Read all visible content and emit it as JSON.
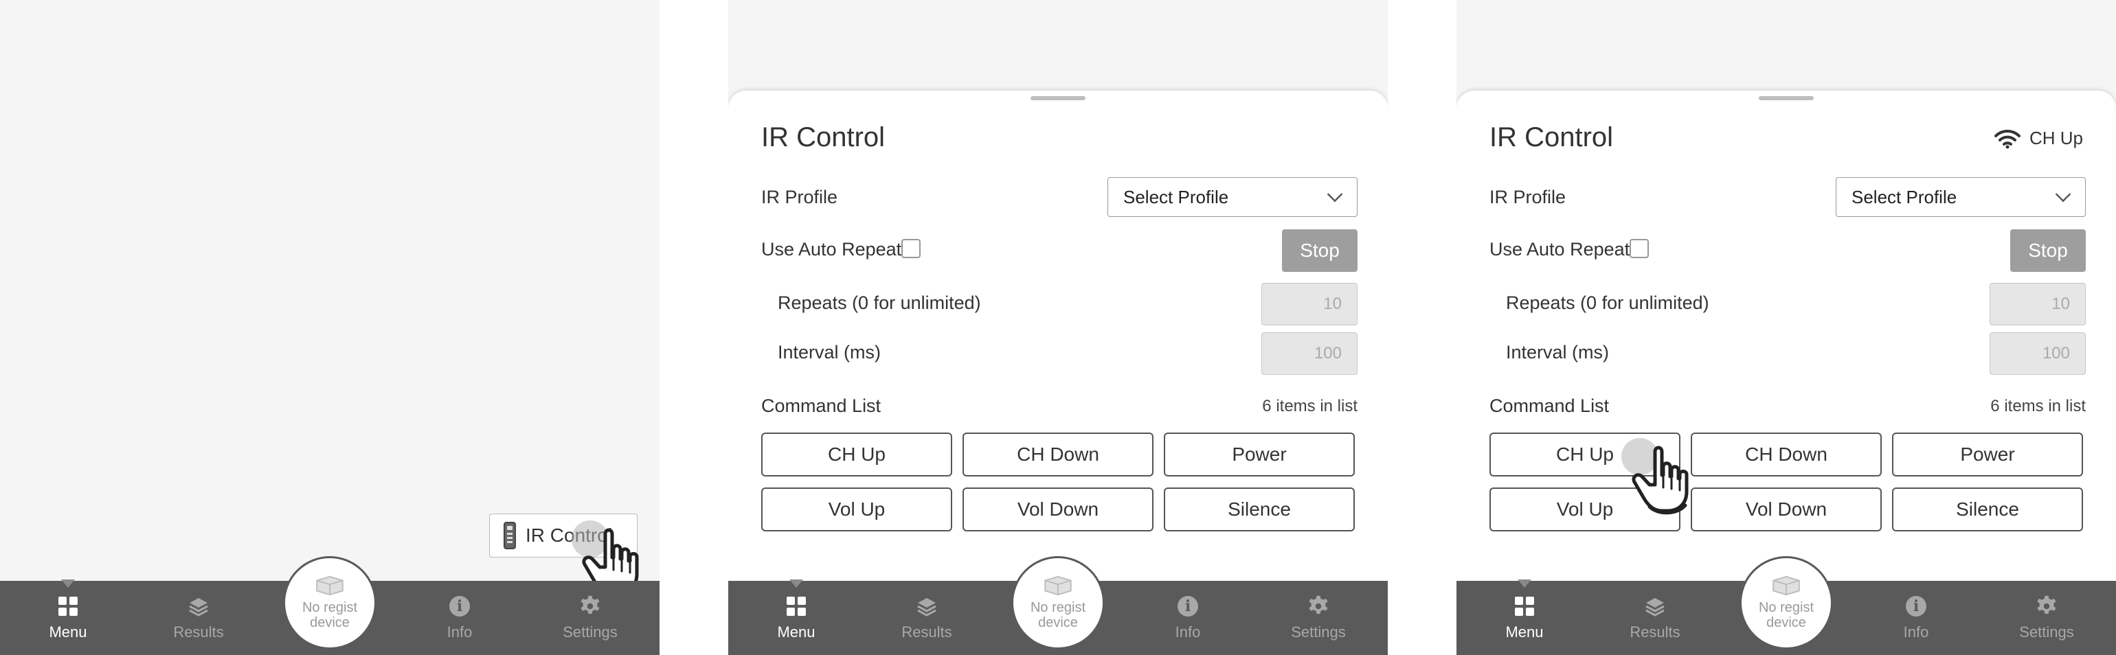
{
  "screens": [
    {
      "fab_label": "IR Control"
    },
    {
      "title": "IR Control",
      "status": "",
      "ir_profile_label": "IR Profile",
      "select_value": "Select Profile",
      "auto_repeat_label": "Use Auto Repeat",
      "stop_label": "Stop",
      "repeats_label": "Repeats (0 for unlimited)",
      "repeats_value": "10",
      "interval_label": "Interval (ms)",
      "interval_value": "100",
      "command_list_label": "Command List",
      "items_count": "6 items in list",
      "commands": [
        "CH Up",
        "CH Down",
        "Power",
        "Vol Up",
        "Vol Down",
        "Silence"
      ]
    },
    {
      "title": "IR Control",
      "status": "CH Up",
      "ir_profile_label": "IR Profile",
      "select_value": "Select Profile",
      "auto_repeat_label": "Use Auto Repeat",
      "stop_label": "Stop",
      "repeats_label": "Repeats (0 for unlimited)",
      "repeats_value": "10",
      "interval_label": "Interval (ms)",
      "interval_value": "100",
      "command_list_label": "Command List",
      "items_count": "6 items in list",
      "commands": [
        "CH Up",
        "CH Down",
        "Power",
        "Vol Up",
        "Vol Down",
        "Silence"
      ]
    }
  ],
  "nav": {
    "menu": "Menu",
    "results": "Results",
    "device_line1": "No regist",
    "device_line2": "device",
    "info": "Info",
    "settings": "Settings"
  },
  "icons": {
    "remote": "remote-control-icon",
    "wifi": "wifi-icon",
    "hand": "tap-hand-icon",
    "menu": "grid-icon",
    "results": "layers-icon",
    "device": "cube-icon",
    "info": "info-icon",
    "settings": "gear-icon"
  },
  "colors": {
    "nav_bg": "#5a5a5a",
    "page_bg": "#f5f5f5",
    "stop_bg": "#9e9e9e"
  }
}
